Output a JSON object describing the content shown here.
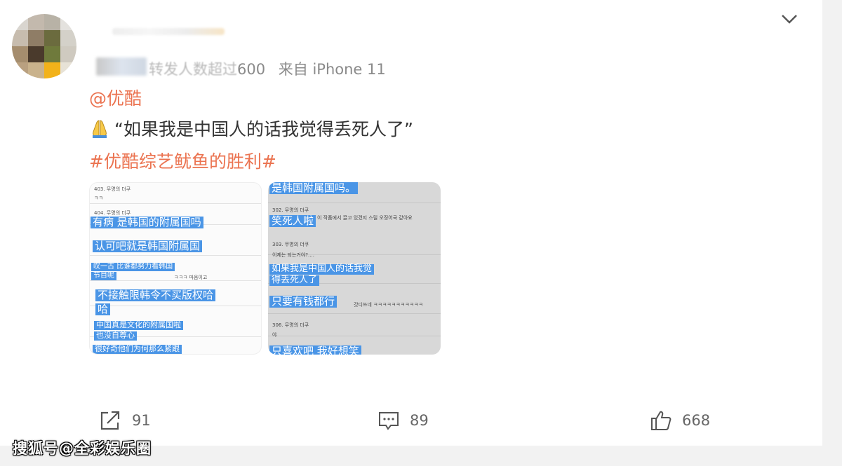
{
  "post": {
    "meta_hidden": "转发人数超过",
    "meta_count": "600",
    "source": "来自 iPhone 11",
    "mention": "@优酷",
    "quote": "“如果我是中国人的话我觉得丢死人了”",
    "hashtag": "#优酷综艺鱿鱼的胜利#"
  },
  "images": {
    "left": {
      "rows": [
        "403. 무명의 더쿠",
        "ㅋㅋ",
        "404. 무명의 더쿠",
        "ㅋㅋㅋ 마음이고"
      ],
      "highlights": [
        "有病 是韩国的附属国吗",
        "认可吧就是韩国附属国",
        "叹一古 比谁都努力看韩国",
        "节目呢",
        "不接触限韩令不买版权哈",
        "哈",
        "中国真是文化的附属国啦",
        "也没自尊心",
        "很好奇他们为何那么紧跟"
      ]
    },
    "right": {
      "rows": [
        "302. 무명의 더쿠",
        "이 작품에서 끌고 있겠지 스릴 오징어국 같아요",
        "303. 무명의 더쿠",
        "이제는 되는거야?....",
        "갓디쓰네 ㅋㅋㅋㅋㅋㅋㅋㅋㅋㅋㅋ",
        "306. 무명의 더쿠",
        "야"
      ],
      "highlights": [
        "是韩国附属国吗。",
        "笑死人啦",
        "如果我是中国人的话我觉",
        "得丢死人了",
        "只要有钱都行",
        "只喜欢吧 我好想笑"
      ]
    }
  },
  "actions": {
    "repost_count": "91",
    "comment_count": "89",
    "like_count": "668"
  },
  "watermark": "搜狐号@全彩娱乐圈",
  "colors": {
    "link": "#eb7350",
    "text": "#333333",
    "meta": "#8a8a8a",
    "highlight": "#4a95e6"
  }
}
